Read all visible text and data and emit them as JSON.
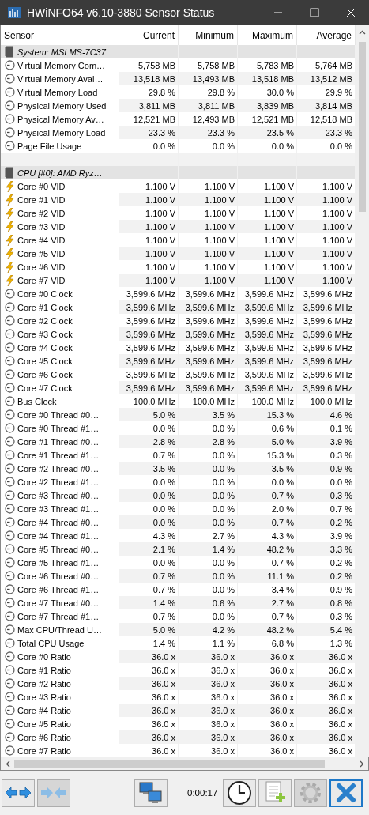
{
  "window": {
    "title": "HWiNFO64 v6.10-3880 Sensor Status"
  },
  "table": {
    "columns": [
      "Sensor",
      "Current",
      "Minimum",
      "Maximum",
      "Average"
    ],
    "rows": [
      {
        "kind": "group",
        "label": "System: MSI MS-7C37"
      },
      {
        "kind": "gauge",
        "label": "Virtual Memory Com…",
        "values": [
          "5,758 MB",
          "5,758 MB",
          "5,783 MB",
          "5,764 MB"
        ]
      },
      {
        "kind": "gauge",
        "label": "Virtual Memory Avai…",
        "values": [
          "13,518 MB",
          "13,493 MB",
          "13,518 MB",
          "13,512 MB"
        ]
      },
      {
        "kind": "gauge",
        "label": "Virtual Memory Load",
        "values": [
          "29.8 %",
          "29.8 %",
          "30.0 %",
          "29.9 %"
        ]
      },
      {
        "kind": "gauge",
        "label": "Physical Memory Used",
        "values": [
          "3,811 MB",
          "3,811 MB",
          "3,839 MB",
          "3,814 MB"
        ]
      },
      {
        "kind": "gauge",
        "label": "Physical Memory Av…",
        "values": [
          "12,521 MB",
          "12,493 MB",
          "12,521 MB",
          "12,518 MB"
        ]
      },
      {
        "kind": "gauge",
        "label": "Physical Memory Load",
        "values": [
          "23.3 %",
          "23.3 %",
          "23.5 %",
          "23.3 %"
        ]
      },
      {
        "kind": "gauge",
        "label": "Page File Usage",
        "values": [
          "0.0 %",
          "0.0 %",
          "0.0 %",
          "0.0 %"
        ]
      },
      {
        "kind": "blank"
      },
      {
        "kind": "group",
        "label": "CPU [#0]: AMD Ryz…"
      },
      {
        "kind": "voltage",
        "label": "Core #0 VID",
        "values": [
          "1.100 V",
          "1.100 V",
          "1.100 V",
          "1.100 V"
        ]
      },
      {
        "kind": "voltage",
        "label": "Core #1 VID",
        "values": [
          "1.100 V",
          "1.100 V",
          "1.100 V",
          "1.100 V"
        ]
      },
      {
        "kind": "voltage",
        "label": "Core #2 VID",
        "values": [
          "1.100 V",
          "1.100 V",
          "1.100 V",
          "1.100 V"
        ]
      },
      {
        "kind": "voltage",
        "label": "Core #3 VID",
        "values": [
          "1.100 V",
          "1.100 V",
          "1.100 V",
          "1.100 V"
        ]
      },
      {
        "kind": "voltage",
        "label": "Core #4 VID",
        "values": [
          "1.100 V",
          "1.100 V",
          "1.100 V",
          "1.100 V"
        ]
      },
      {
        "kind": "voltage",
        "label": "Core #5 VID",
        "values": [
          "1.100 V",
          "1.100 V",
          "1.100 V",
          "1.100 V"
        ]
      },
      {
        "kind": "voltage",
        "label": "Core #6 VID",
        "values": [
          "1.100 V",
          "1.100 V",
          "1.100 V",
          "1.100 V"
        ]
      },
      {
        "kind": "voltage",
        "label": "Core #7 VID",
        "values": [
          "1.100 V",
          "1.100 V",
          "1.100 V",
          "1.100 V"
        ]
      },
      {
        "kind": "gauge",
        "label": "Core #0 Clock",
        "values": [
          "3,599.6 MHz",
          "3,599.6 MHz",
          "3,599.6 MHz",
          "3,599.6 MHz"
        ]
      },
      {
        "kind": "gauge",
        "label": "Core #1 Clock",
        "values": [
          "3,599.6 MHz",
          "3,599.6 MHz",
          "3,599.6 MHz",
          "3,599.6 MHz"
        ]
      },
      {
        "kind": "gauge",
        "label": "Core #2 Clock",
        "values": [
          "3,599.6 MHz",
          "3,599.6 MHz",
          "3,599.6 MHz",
          "3,599.6 MHz"
        ]
      },
      {
        "kind": "gauge",
        "label": "Core #3 Clock",
        "values": [
          "3,599.6 MHz",
          "3,599.6 MHz",
          "3,599.6 MHz",
          "3,599.6 MHz"
        ]
      },
      {
        "kind": "gauge",
        "label": "Core #4 Clock",
        "values": [
          "3,599.6 MHz",
          "3,599.6 MHz",
          "3,599.6 MHz",
          "3,599.6 MHz"
        ]
      },
      {
        "kind": "gauge",
        "label": "Core #5 Clock",
        "values": [
          "3,599.6 MHz",
          "3,599.6 MHz",
          "3,599.6 MHz",
          "3,599.6 MHz"
        ]
      },
      {
        "kind": "gauge",
        "label": "Core #6 Clock",
        "values": [
          "3,599.6 MHz",
          "3,599.6 MHz",
          "3,599.6 MHz",
          "3,599.6 MHz"
        ]
      },
      {
        "kind": "gauge",
        "label": "Core #7 Clock",
        "values": [
          "3,599.6 MHz",
          "3,599.6 MHz",
          "3,599.6 MHz",
          "3,599.6 MHz"
        ]
      },
      {
        "kind": "gauge",
        "label": "Bus Clock",
        "values": [
          "100.0 MHz",
          "100.0 MHz",
          "100.0 MHz",
          "100.0 MHz"
        ]
      },
      {
        "kind": "gauge",
        "label": "Core #0 Thread #0…",
        "values": [
          "5.0 %",
          "3.5 %",
          "15.3 %",
          "4.6 %"
        ]
      },
      {
        "kind": "gauge",
        "label": "Core #0 Thread #1…",
        "values": [
          "0.0 %",
          "0.0 %",
          "0.6 %",
          "0.1 %"
        ]
      },
      {
        "kind": "gauge",
        "label": "Core #1 Thread #0…",
        "values": [
          "2.8 %",
          "2.8 %",
          "5.0 %",
          "3.9 %"
        ]
      },
      {
        "kind": "gauge",
        "label": "Core #1 Thread #1…",
        "values": [
          "0.7 %",
          "0.0 %",
          "15.3 %",
          "0.3 %"
        ]
      },
      {
        "kind": "gauge",
        "label": "Core #2 Thread #0…",
        "values": [
          "3.5 %",
          "0.0 %",
          "3.5 %",
          "0.9 %"
        ]
      },
      {
        "kind": "gauge",
        "label": "Core #2 Thread #1…",
        "values": [
          "0.0 %",
          "0.0 %",
          "0.0 %",
          "0.0 %"
        ]
      },
      {
        "kind": "gauge",
        "label": "Core #3 Thread #0…",
        "values": [
          "0.0 %",
          "0.0 %",
          "0.7 %",
          "0.3 %"
        ]
      },
      {
        "kind": "gauge",
        "label": "Core #3 Thread #1…",
        "values": [
          "0.0 %",
          "0.0 %",
          "2.0 %",
          "0.7 %"
        ]
      },
      {
        "kind": "gauge",
        "label": "Core #4 Thread #0…",
        "values": [
          "0.0 %",
          "0.0 %",
          "0.7 %",
          "0.2 %"
        ]
      },
      {
        "kind": "gauge",
        "label": "Core #4 Thread #1…",
        "values": [
          "4.3 %",
          "2.7 %",
          "4.3 %",
          "3.9 %"
        ]
      },
      {
        "kind": "gauge",
        "label": "Core #5 Thread #0…",
        "values": [
          "2.1 %",
          "1.4 %",
          "48.2 %",
          "3.3 %"
        ]
      },
      {
        "kind": "gauge",
        "label": "Core #5 Thread #1…",
        "values": [
          "0.0 %",
          "0.0 %",
          "0.7 %",
          "0.2 %"
        ]
      },
      {
        "kind": "gauge",
        "label": "Core #6 Thread #0…",
        "values": [
          "0.7 %",
          "0.0 %",
          "11.1 %",
          "0.2 %"
        ]
      },
      {
        "kind": "gauge",
        "label": "Core #6 Thread #1…",
        "values": [
          "0.7 %",
          "0.0 %",
          "3.4 %",
          "0.9 %"
        ]
      },
      {
        "kind": "gauge",
        "label": "Core #7 Thread #0…",
        "values": [
          "1.4 %",
          "0.6 %",
          "2.7 %",
          "0.8 %"
        ]
      },
      {
        "kind": "gauge",
        "label": "Core #7 Thread #1…",
        "values": [
          "0.7 %",
          "0.0 %",
          "0.7 %",
          "0.3 %"
        ]
      },
      {
        "kind": "gauge",
        "label": "Max CPU/Thread U…",
        "values": [
          "5.0 %",
          "4.2 %",
          "48.2 %",
          "5.4 %"
        ]
      },
      {
        "kind": "gauge",
        "label": "Total CPU Usage",
        "values": [
          "1.4 %",
          "1.1 %",
          "6.8 %",
          "1.3 %"
        ]
      },
      {
        "kind": "gauge",
        "label": "Core #0 Ratio",
        "values": [
          "36.0 x",
          "36.0 x",
          "36.0 x",
          "36.0 x"
        ]
      },
      {
        "kind": "gauge",
        "label": "Core #1 Ratio",
        "values": [
          "36.0 x",
          "36.0 x",
          "36.0 x",
          "36.0 x"
        ]
      },
      {
        "kind": "gauge",
        "label": "Core #2 Ratio",
        "values": [
          "36.0 x",
          "36.0 x",
          "36.0 x",
          "36.0 x"
        ]
      },
      {
        "kind": "gauge",
        "label": "Core #3 Ratio",
        "values": [
          "36.0 x",
          "36.0 x",
          "36.0 x",
          "36.0 x"
        ]
      },
      {
        "kind": "gauge",
        "label": "Core #4 Ratio",
        "values": [
          "36.0 x",
          "36.0 x",
          "36.0 x",
          "36.0 x"
        ]
      },
      {
        "kind": "gauge",
        "label": "Core #5 Ratio",
        "values": [
          "36.0 x",
          "36.0 x",
          "36.0 x",
          "36.0 x"
        ]
      },
      {
        "kind": "gauge",
        "label": "Core #6 Ratio",
        "values": [
          "36.0 x",
          "36.0 x",
          "36.0 x",
          "36.0 x"
        ]
      },
      {
        "kind": "gauge",
        "label": "Core #7 Ratio",
        "values": [
          "36.0 x",
          "36.0 x",
          "36.0 x",
          "36.0 x"
        ]
      }
    ]
  },
  "toolbar": {
    "left": [
      {
        "kind": "expand",
        "disabled": false
      },
      {
        "kind": "collapse",
        "disabled": true
      }
    ],
    "network": {
      "kind": "network",
      "disabled": false
    },
    "timer": "0:00:17",
    "right": [
      {
        "kind": "clock",
        "disabled": false
      },
      {
        "kind": "report",
        "disabled": false
      },
      {
        "kind": "settings",
        "disabled": true
      },
      {
        "kind": "close",
        "disabled": false,
        "selected": true
      }
    ]
  }
}
